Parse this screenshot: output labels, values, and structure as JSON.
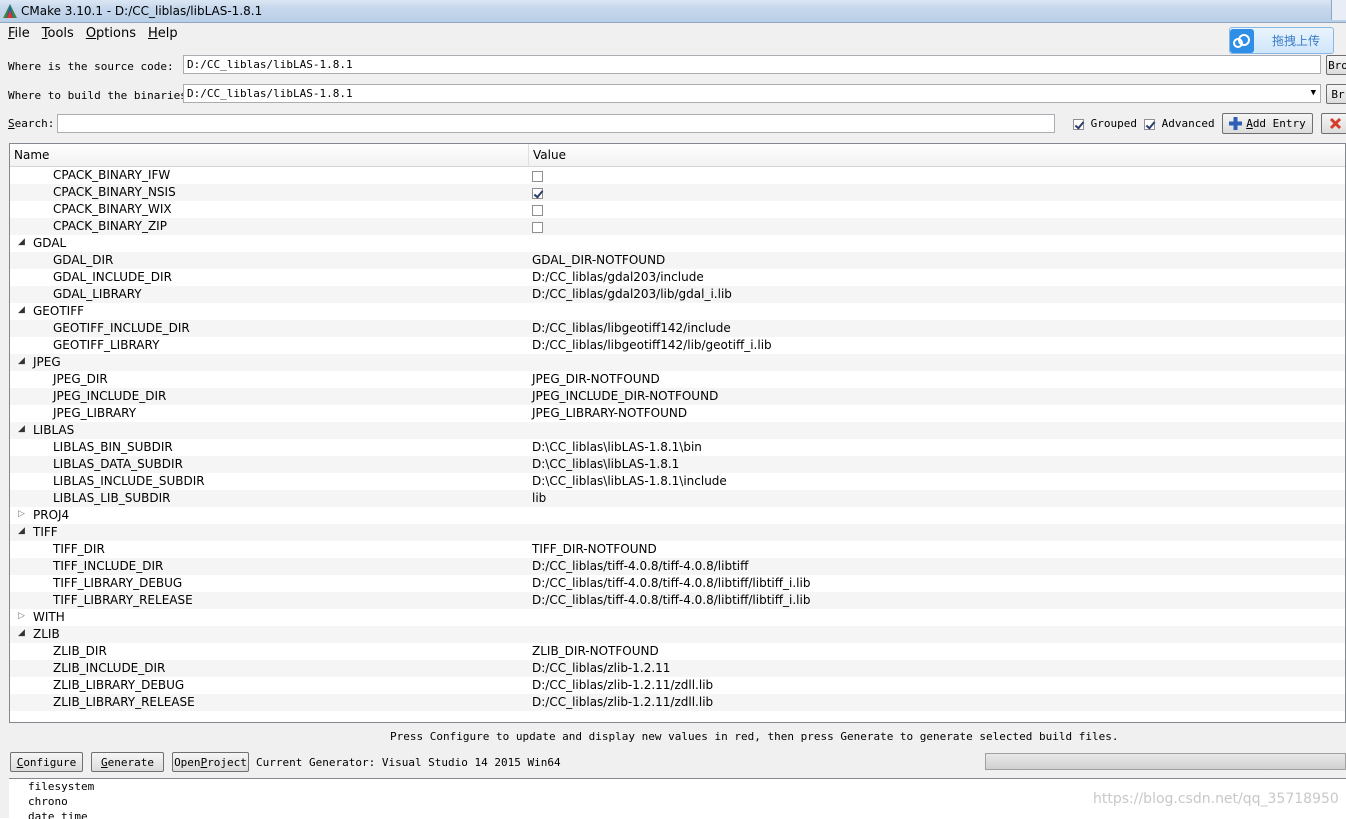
{
  "window": {
    "title": "CMake 3.10.1 - D:/CC_liblas/libLAS-1.8.1"
  },
  "menu": [
    {
      "label": "File",
      "key": "F",
      "rest": "ile"
    },
    {
      "label": "Tools",
      "key": "T",
      "rest": "ools"
    },
    {
      "label": "Options",
      "key": "O",
      "rest": "ptions"
    },
    {
      "label": "Help",
      "key": "H",
      "rest": "elp"
    }
  ],
  "upload": {
    "label": "拖拽上传"
  },
  "source": {
    "label": "Where is the source code:",
    "value": "D:/CC_liblas/libLAS-1.8.1",
    "browse": "Bro"
  },
  "build": {
    "label": "Where to build the binaries:",
    "value": "D:/CC_liblas/libLAS-1.8.1",
    "browse": "Br"
  },
  "search": {
    "label_key": "S",
    "label_rest": "earch:",
    "value": "",
    "grouped_label": "Grouped",
    "grouped_checked": true,
    "advanced_label": "Advanced",
    "advanced_checked": true,
    "add_entry_key": "A",
    "add_entry_rest": "dd Entry"
  },
  "table": {
    "col_name": "Name",
    "col_value": "Value",
    "rows": [
      {
        "type": "entry",
        "name": "CPACK_BINARY_IFW",
        "kind": "bool",
        "checked": false
      },
      {
        "type": "entry",
        "name": "CPACK_BINARY_NSIS",
        "kind": "bool",
        "checked": true
      },
      {
        "type": "entry",
        "name": "CPACK_BINARY_WIX",
        "kind": "bool",
        "checked": false
      },
      {
        "type": "entry",
        "name": "CPACK_BINARY_ZIP",
        "kind": "bool",
        "checked": false
      },
      {
        "type": "group",
        "name": "GDAL",
        "expanded": true
      },
      {
        "type": "entry",
        "name": "GDAL_DIR",
        "kind": "text",
        "value": "GDAL_DIR-NOTFOUND"
      },
      {
        "type": "entry",
        "name": "GDAL_INCLUDE_DIR",
        "kind": "text",
        "value": "D:/CC_liblas/gdal203/include"
      },
      {
        "type": "entry",
        "name": "GDAL_LIBRARY",
        "kind": "text",
        "value": "D:/CC_liblas/gdal203/lib/gdal_i.lib"
      },
      {
        "type": "group",
        "name": "GEOTIFF",
        "expanded": true
      },
      {
        "type": "entry",
        "name": "GEOTIFF_INCLUDE_DIR",
        "kind": "text",
        "value": "D:/CC_liblas/libgeotiff142/include"
      },
      {
        "type": "entry",
        "name": "GEOTIFF_LIBRARY",
        "kind": "text",
        "value": "D:/CC_liblas/libgeotiff142/lib/geotiff_i.lib"
      },
      {
        "type": "group",
        "name": "JPEG",
        "expanded": true
      },
      {
        "type": "entry",
        "name": "JPEG_DIR",
        "kind": "text",
        "value": "JPEG_DIR-NOTFOUND"
      },
      {
        "type": "entry",
        "name": "JPEG_INCLUDE_DIR",
        "kind": "text",
        "value": "JPEG_INCLUDE_DIR-NOTFOUND"
      },
      {
        "type": "entry",
        "name": "JPEG_LIBRARY",
        "kind": "text",
        "value": "JPEG_LIBRARY-NOTFOUND"
      },
      {
        "type": "group",
        "name": "LIBLAS",
        "expanded": true
      },
      {
        "type": "entry",
        "name": "LIBLAS_BIN_SUBDIR",
        "kind": "text",
        "value": "D:\\CC_liblas\\libLAS-1.8.1\\bin"
      },
      {
        "type": "entry",
        "name": "LIBLAS_DATA_SUBDIR",
        "kind": "text",
        "value": "D:\\CC_liblas\\libLAS-1.8.1"
      },
      {
        "type": "entry",
        "name": "LIBLAS_INCLUDE_SUBDIR",
        "kind": "text",
        "value": "D:\\CC_liblas\\libLAS-1.8.1\\include"
      },
      {
        "type": "entry",
        "name": "LIBLAS_LIB_SUBDIR",
        "kind": "text",
        "value": "lib"
      },
      {
        "type": "group",
        "name": "PROJ4",
        "expanded": false
      },
      {
        "type": "group",
        "name": "TIFF",
        "expanded": true
      },
      {
        "type": "entry",
        "name": "TIFF_DIR",
        "kind": "text",
        "value": "TIFF_DIR-NOTFOUND"
      },
      {
        "type": "entry",
        "name": "TIFF_INCLUDE_DIR",
        "kind": "text",
        "value": "D:/CC_liblas/tiff-4.0.8/tiff-4.0.8/libtiff"
      },
      {
        "type": "entry",
        "name": "TIFF_LIBRARY_DEBUG",
        "kind": "text",
        "value": "D:/CC_liblas/tiff-4.0.8/tiff-4.0.8/libtiff/libtiff_i.lib"
      },
      {
        "type": "entry",
        "name": "TIFF_LIBRARY_RELEASE",
        "kind": "text",
        "value": "D:/CC_liblas/tiff-4.0.8/tiff-4.0.8/libtiff/libtiff_i.lib"
      },
      {
        "type": "group",
        "name": "WITH",
        "expanded": false
      },
      {
        "type": "group",
        "name": "ZLIB",
        "expanded": true
      },
      {
        "type": "entry",
        "name": "ZLIB_DIR",
        "kind": "text",
        "value": "ZLIB_DIR-NOTFOUND"
      },
      {
        "type": "entry",
        "name": "ZLIB_INCLUDE_DIR",
        "kind": "text",
        "value": "D:/CC_liblas/zlib-1.2.11"
      },
      {
        "type": "entry",
        "name": "ZLIB_LIBRARY_DEBUG",
        "kind": "text",
        "value": "D:/CC_liblas/zlib-1.2.11/zdll.lib"
      },
      {
        "type": "entry",
        "name": "ZLIB_LIBRARY_RELEASE",
        "kind": "text",
        "value": "D:/CC_liblas/zlib-1.2.11/zdll.lib"
      }
    ]
  },
  "status_message": "Press Configure to update and display new values in red, then press Generate to generate selected build files.",
  "buttons": {
    "configure_key": "C",
    "configure_rest": "onfigure",
    "generate_key": "G",
    "generate_rest": "enerate",
    "open_project_pre": "Open ",
    "open_project_key": "P",
    "open_project_rest": "roject"
  },
  "generator": "Current Generator: Visual Studio 14 2015 Win64",
  "output_lines": [
    "filesystem",
    "chrono",
    "date_time"
  ],
  "watermark": "https://blog.csdn.net/qq_35718950",
  "colors": {
    "accent": "#2f8fe6",
    "grid_alt": "#f5f5f5"
  }
}
